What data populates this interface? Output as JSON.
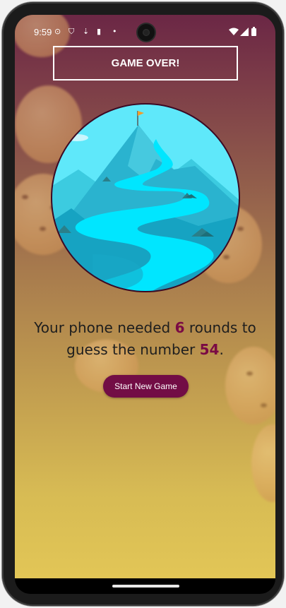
{
  "status_bar": {
    "time": "9:59",
    "icons": [
      "record-icon",
      "shield-icon",
      "usb-icon",
      "sd-card-icon",
      "dot-icon",
      "wifi-icon",
      "signal-icon",
      "battery-icon"
    ]
  },
  "screen": {
    "title": "GAME OVER!",
    "message": {
      "prefix": "Your phone needed",
      "rounds": "6",
      "middle": "rounds to guess the number",
      "number": "54",
      "suffix": "."
    },
    "button_label": "Start New Game"
  },
  "colors": {
    "accent": "#720d45",
    "highlight": "#7a0a44",
    "gradient_top": "#6b2745",
    "gradient_bottom": "#e2c656",
    "sky": "#5fe3f5",
    "river": "#00e5ff"
  }
}
